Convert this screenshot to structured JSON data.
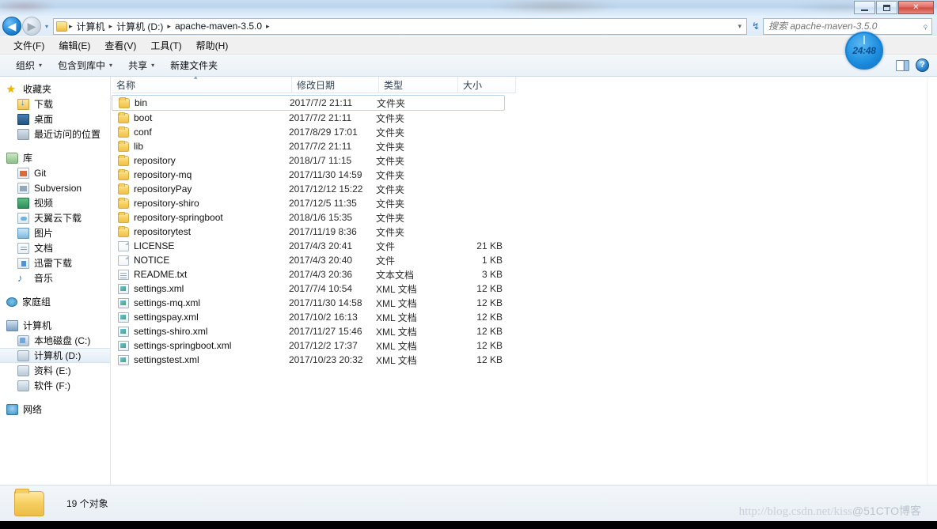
{
  "window": {
    "controls": {
      "minimize": "—",
      "maximize": "□",
      "close": "✕"
    }
  },
  "address_bar": {
    "back_glyph": "◀",
    "forward_glyph": "▶",
    "history_caret": "▾",
    "folder_icon": "folder-icon",
    "breadcrumbs": [
      "计算机",
      "计算机 (D:)",
      "apache-maven-3.5.0"
    ],
    "separator": "▸",
    "dropdown_caret": "▾",
    "refresh_glyph": "↯",
    "search": {
      "placeholder": "搜索 apache-maven-3.5.0",
      "value": "",
      "icon": "search-icon"
    }
  },
  "menubar": {
    "items": [
      {
        "label": "文件(F)"
      },
      {
        "label": "编辑(E)"
      },
      {
        "label": "查看(V)"
      },
      {
        "label": "工具(T)"
      },
      {
        "label": "帮助(H)"
      }
    ]
  },
  "toolbar": {
    "items": [
      {
        "label": "组织",
        "caret": "▾"
      },
      {
        "label": "包含到库中",
        "caret": "▾"
      },
      {
        "label": "共享",
        "caret": "▾"
      },
      {
        "label": "新建文件夹",
        "caret": ""
      }
    ],
    "preview_pane_icon": "preview-pane-icon",
    "help_label": "?"
  },
  "timer_overlay": {
    "value": "24:48",
    "color": "#1f8fe0"
  },
  "sidebar": {
    "groups": [
      {
        "root": {
          "label": "收藏夹",
          "icon": "star-icon"
        },
        "items": [
          {
            "label": "下载",
            "icon": "downloads-icon"
          },
          {
            "label": "桌面",
            "icon": "desktop-icon"
          },
          {
            "label": "最近访问的位置",
            "icon": "recent-places-icon"
          }
        ]
      },
      {
        "root": {
          "label": "库",
          "icon": "library-icon"
        },
        "items": [
          {
            "label": "Git",
            "icon": "git-icon"
          },
          {
            "label": "Subversion",
            "icon": "subversion-icon"
          },
          {
            "label": "视频",
            "icon": "video-icon"
          },
          {
            "label": "天翼云下载",
            "icon": "cloud-download-icon"
          },
          {
            "label": "图片",
            "icon": "pictures-icon"
          },
          {
            "label": "文档",
            "icon": "documents-icon"
          },
          {
            "label": "迅雷下载",
            "icon": "thunder-download-icon"
          },
          {
            "label": "音乐",
            "icon": "music-icon"
          }
        ]
      },
      {
        "root": {
          "label": "家庭组",
          "icon": "homegroup-icon"
        },
        "items": []
      },
      {
        "root": {
          "label": "计算机",
          "icon": "computer-icon"
        },
        "items": [
          {
            "label": "本地磁盘 (C:)",
            "icon": "system-drive-icon",
            "selected": false
          },
          {
            "label": "计算机 (D:)",
            "icon": "drive-icon",
            "selected": true
          },
          {
            "label": "资料 (E:)",
            "icon": "drive-icon",
            "selected": false
          },
          {
            "label": "软件 (F:)",
            "icon": "drive-icon",
            "selected": false
          }
        ]
      },
      {
        "root": {
          "label": "网络",
          "icon": "network-icon"
        },
        "items": []
      }
    ]
  },
  "file_list": {
    "columns": [
      "名称",
      "修改日期",
      "类型",
      "大小"
    ],
    "sort_indicator": "▴",
    "rows": [
      {
        "name": "bin",
        "date": "2017/7/2 21:11",
        "type": "文件夹",
        "size": "",
        "icon": "folder",
        "focused": true
      },
      {
        "name": "boot",
        "date": "2017/7/2 21:11",
        "type": "文件夹",
        "size": "",
        "icon": "folder",
        "focused": false
      },
      {
        "name": "conf",
        "date": "2017/8/29 17:01",
        "type": "文件夹",
        "size": "",
        "icon": "folder",
        "focused": false
      },
      {
        "name": "lib",
        "date": "2017/7/2 21:11",
        "type": "文件夹",
        "size": "",
        "icon": "folder",
        "focused": false
      },
      {
        "name": "repository",
        "date": "2018/1/7 11:15",
        "type": "文件夹",
        "size": "",
        "icon": "folder",
        "focused": false
      },
      {
        "name": "repository-mq",
        "date": "2017/11/30 14:59",
        "type": "文件夹",
        "size": "",
        "icon": "folder",
        "focused": false
      },
      {
        "name": "repositoryPay",
        "date": "2017/12/12 15:22",
        "type": "文件夹",
        "size": "",
        "icon": "folder",
        "focused": false
      },
      {
        "name": "repository-shiro",
        "date": "2017/12/5 11:35",
        "type": "文件夹",
        "size": "",
        "icon": "folder",
        "focused": false
      },
      {
        "name": "repository-springboot",
        "date": "2018/1/6 15:35",
        "type": "文件夹",
        "size": "",
        "icon": "folder",
        "focused": false
      },
      {
        "name": "repositorytest",
        "date": "2017/11/19 8:36",
        "type": "文件夹",
        "size": "",
        "icon": "folder",
        "focused": false
      },
      {
        "name": "LICENSE",
        "date": "2017/4/3 20:41",
        "type": "文件",
        "size": "21 KB",
        "icon": "file",
        "focused": false
      },
      {
        "name": "NOTICE",
        "date": "2017/4/3 20:40",
        "type": "文件",
        "size": "1 KB",
        "icon": "file",
        "focused": false
      },
      {
        "name": "README.txt",
        "date": "2017/4/3 20:36",
        "type": "文本文档",
        "size": "3 KB",
        "icon": "txt",
        "focused": false
      },
      {
        "name": "settings.xml",
        "date": "2017/7/4 10:54",
        "type": "XML 文档",
        "size": "12 KB",
        "icon": "xml",
        "focused": false
      },
      {
        "name": "settings-mq.xml",
        "date": "2017/11/30 14:58",
        "type": "XML 文档",
        "size": "12 KB",
        "icon": "xml",
        "focused": false
      },
      {
        "name": "settingspay.xml",
        "date": "2017/10/2 16:13",
        "type": "XML 文档",
        "size": "12 KB",
        "icon": "xml",
        "focused": false
      },
      {
        "name": "settings-shiro.xml",
        "date": "2017/11/27 15:46",
        "type": "XML 文档",
        "size": "12 KB",
        "icon": "xml",
        "focused": false
      },
      {
        "name": "settings-springboot.xml",
        "date": "2017/12/2 17:37",
        "type": "XML 文档",
        "size": "12 KB",
        "icon": "xml",
        "focused": false
      },
      {
        "name": "settingstest.xml",
        "date": "2017/10/23 20:32",
        "type": "XML 文档",
        "size": "12 KB",
        "icon": "xml",
        "focused": false
      }
    ]
  },
  "status_bar": {
    "item_count": "19 个对象",
    "folder_icon": "folder-icon"
  },
  "watermark": {
    "url": "http://blog.csdn.net/kiss",
    "suffix": "@51CTO博客"
  }
}
